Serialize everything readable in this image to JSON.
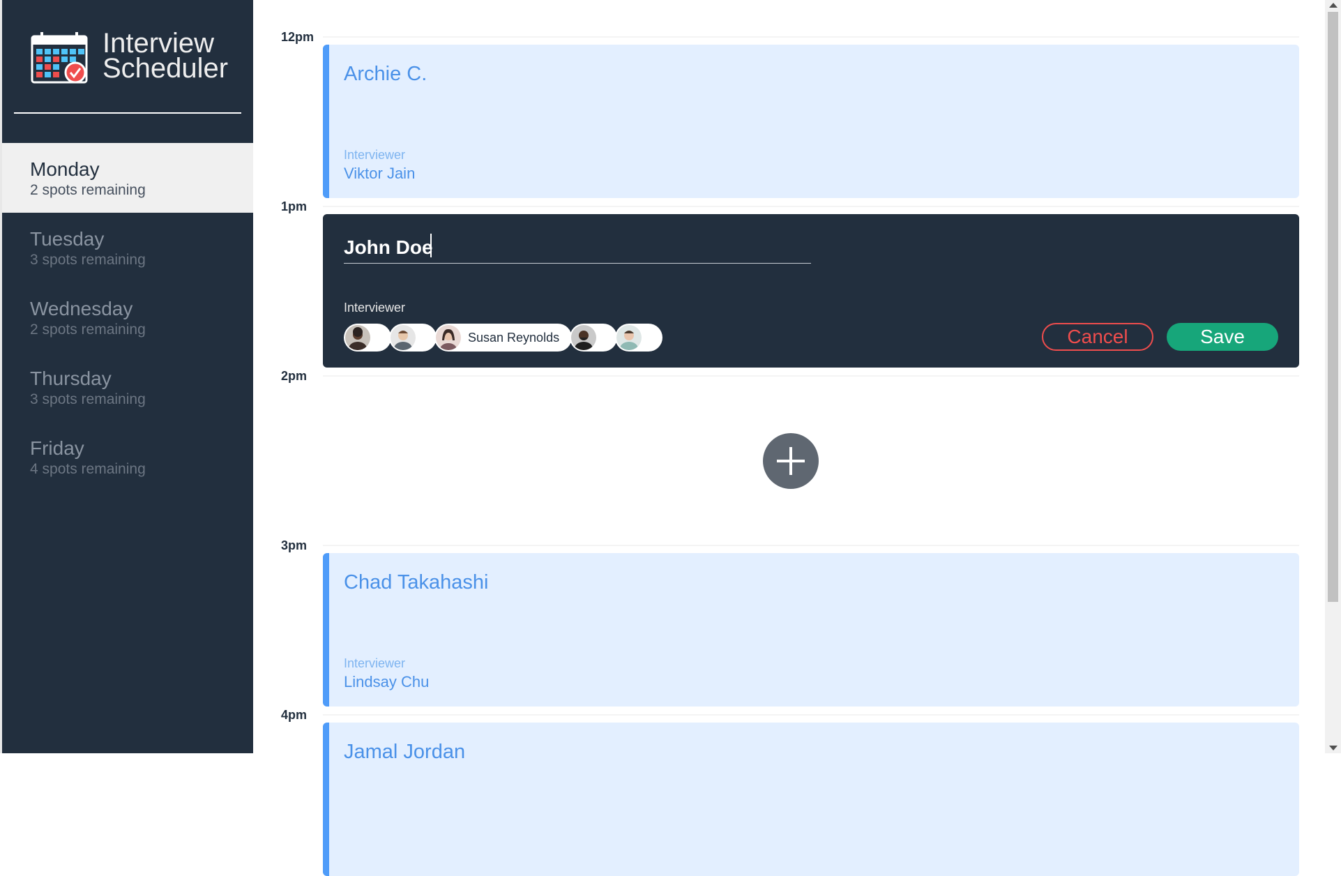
{
  "brand": {
    "line1": "Interview",
    "line2": "Scheduler",
    "logo_icon": "calendar-check-icon"
  },
  "days": [
    {
      "name": "Monday",
      "spots": "2 spots remaining",
      "selected": true
    },
    {
      "name": "Tuesday",
      "spots": "3 spots remaining"
    },
    {
      "name": "Wednesday",
      "spots": "2 spots remaining"
    },
    {
      "name": "Thursday",
      "spots": "3 spots remaining"
    },
    {
      "name": "Friday",
      "spots": "4 spots remaining"
    }
  ],
  "schedule": {
    "slots": [
      {
        "time": "12pm",
        "student": "Archie C.",
        "interviewer_label": "Interviewer",
        "interviewer": "Viktor Jain"
      },
      {
        "time": "1pm"
      },
      {
        "time": "2pm"
      },
      {
        "time": "3pm",
        "student": "Chad Takahashi",
        "interviewer_label": "Interviewer",
        "interviewer": "Lindsay Chu"
      },
      {
        "time": "4pm",
        "student": "Jamal Jordan"
      }
    ],
    "form": {
      "student_value": "John Doe",
      "interviewer_label": "Interviewer",
      "selected_interviewer": "Susan Reynolds",
      "cancel": "Cancel",
      "save": "Save"
    },
    "add_icon": "plus-circle-icon"
  },
  "colors": {
    "sidebar": "#222f3e",
    "appointment_bg": "#e3efff",
    "accent": "#4f9cf9",
    "cancel": "#ef4d4d",
    "save": "#17a67a"
  }
}
